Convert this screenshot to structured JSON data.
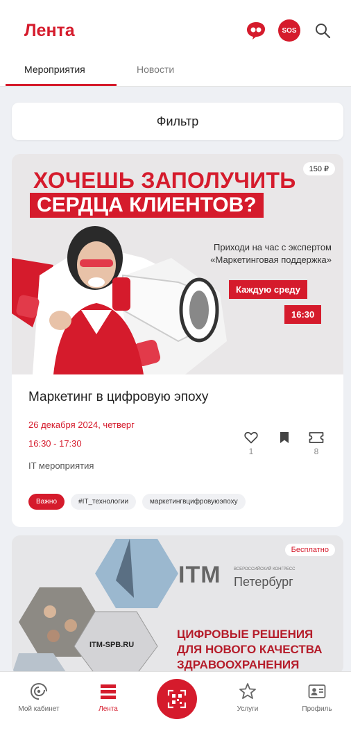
{
  "header": {
    "title": "Лента",
    "sos_label": "SOS"
  },
  "tabs": [
    {
      "label": "Мероприятия",
      "active": true
    },
    {
      "label": "Новости",
      "active": false
    }
  ],
  "filter": {
    "label": "Фильтр"
  },
  "events": [
    {
      "price_badge": "150 ₽",
      "banner": {
        "headline_line1": "ХОЧЕШЬ ЗАПОЛУЧИТЬ",
        "headline_line2": "СЕРДЦА КЛИЕНТОВ?",
        "subtitle_line1": "Приходи на час с экспертом",
        "subtitle_line2": "«Маркетинговая поддержка»",
        "day_label": "Каждую среду",
        "time_label": "16:30"
      },
      "title": "Маркетинг в цифровую эпоху",
      "date": "26 декабря 2024, четверг",
      "time": "16:30 - 17:30",
      "category": "IT мероприятия",
      "likes": "1",
      "tickets": "8",
      "tags": [
        "Важно",
        "#IT_технологии",
        "маркетингвцифровуюэпоху"
      ]
    },
    {
      "price_badge": "Бесплатно",
      "banner": {
        "logo": "ITM",
        "congress": "ВСЕРОССИЙСКИЙ КОНГРЕСС",
        "city": "Петербург",
        "url": "ITM-SPB.RU",
        "slogan_line1": "ЦИФРОВЫЕ РЕШЕНИЯ",
        "slogan_line2": "ДЛЯ НОВОГО КАЧЕСТВА",
        "slogan_line3": "ЗДРАВООХРАНЕНИЯ"
      }
    }
  ],
  "bottom_nav": {
    "items": [
      {
        "label": "Мой кабинет",
        "icon": "cabinet-icon"
      },
      {
        "label": "Лента",
        "icon": "feed-icon",
        "active": true
      },
      {
        "label": "Услуги",
        "icon": "star-icon"
      },
      {
        "label": "Профиль",
        "icon": "profile-icon"
      }
    ],
    "center_icon": "qr-scan-icon"
  },
  "colors": {
    "accent": "#d51b2c",
    "background": "#eef0f4"
  }
}
